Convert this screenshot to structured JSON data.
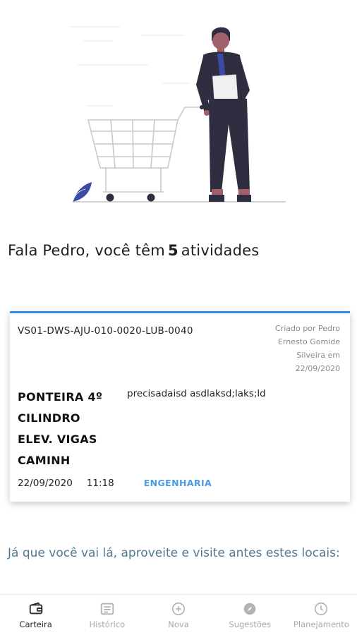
{
  "greeting": {
    "prefix": "Fala Pedro, você têm",
    "count": "5",
    "suffix": "atividades"
  },
  "activity_card": {
    "code": "VS01-DWS-AJU-010-0020-LUB-0040",
    "meta_lines": [
      "Criado por Pedro",
      "Ernesto Gomide",
      "Silveira em",
      "22/09/2020"
    ],
    "title_lines": [
      "PONTEIRA 4º",
      "CILINDRO",
      "ELEV. VIGAS",
      "CAMINH"
    ],
    "description": "precisadaisd asdlaksd;laks;ld",
    "date": "22/09/2020",
    "time": "11:18",
    "department": "ENGENHARIA",
    "accent_color": "#2d8fe6"
  },
  "suggestion_text": "Já que você vai lá, aproveite e visite antes estes locais:",
  "bottom_nav": {
    "items": [
      {
        "label": "Carteira",
        "icon": "wallet-icon",
        "active": true
      },
      {
        "label": "Histórico",
        "icon": "history-icon",
        "active": false
      },
      {
        "label": "Nova",
        "icon": "plus-circle-icon",
        "active": false
      },
      {
        "label": "Sugestões",
        "icon": "compass-icon",
        "active": false
      },
      {
        "label": "Planejamento",
        "icon": "clock-icon",
        "active": false
      }
    ]
  }
}
